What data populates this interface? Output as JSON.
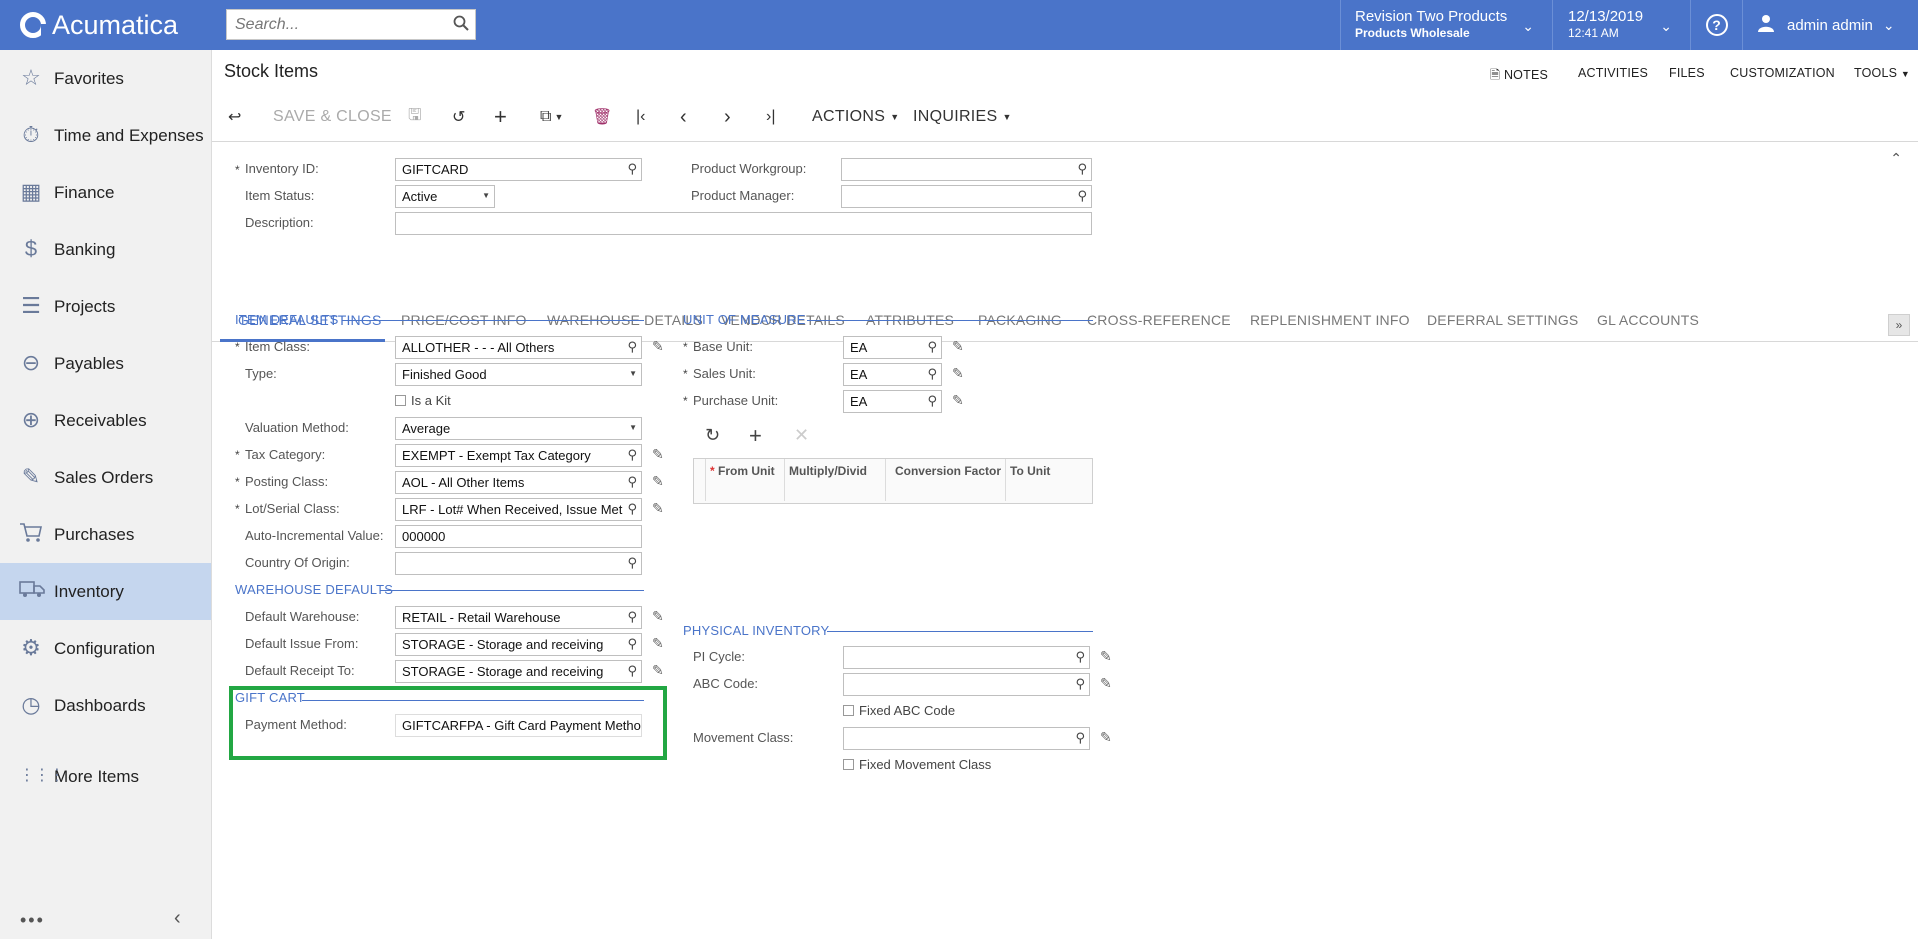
{
  "header": {
    "brand": "Acumatica",
    "search_placeholder": "Search...",
    "company_line1": "Revision Two Products",
    "company_line2": "Products Wholesale",
    "date": "12/13/2019",
    "time": "12:41 AM",
    "help": "?",
    "user": "admin admin"
  },
  "sidebar": {
    "items": [
      {
        "label": "Favorites",
        "icon": "star-icon"
      },
      {
        "label": "Time and Expenses",
        "icon": "stopwatch-icon"
      },
      {
        "label": "Finance",
        "icon": "calculator-icon"
      },
      {
        "label": "Banking",
        "icon": "dollar-icon"
      },
      {
        "label": "Projects",
        "icon": "projects-icon"
      },
      {
        "label": "Payables",
        "icon": "minus-circle-icon"
      },
      {
        "label": "Receivables",
        "icon": "plus-circle-icon"
      },
      {
        "label": "Sales Orders",
        "icon": "edit-icon"
      },
      {
        "label": "Purchases",
        "icon": "cart-icon"
      },
      {
        "label": "Inventory",
        "icon": "truck-icon"
      },
      {
        "label": "Configuration",
        "icon": "gear-icon"
      },
      {
        "label": "Dashboards",
        "icon": "gauge-icon"
      },
      {
        "label": "More Items",
        "icon": "grid-icon"
      }
    ],
    "active": "Inventory"
  },
  "page": {
    "title": "Stock Items",
    "topright": [
      "NOTES",
      "ACTIVITIES",
      "FILES",
      "CUSTOMIZATION",
      "TOOLS"
    ],
    "toolbar": {
      "save_close": "SAVE & CLOSE",
      "actions": "ACTIONS",
      "inquiries": "INQUIRIES"
    }
  },
  "form": {
    "inventory_id_label": "Inventory ID:",
    "inventory_id": "GIFTCARD",
    "item_status_label": "Item Status:",
    "item_status": "Active",
    "description_label": "Description:",
    "description": "",
    "product_workgroup_label": "Product Workgroup:",
    "product_workgroup": "",
    "product_manager_label": "Product Manager:",
    "product_manager": ""
  },
  "tabs": [
    "GENERAL SETTINGS",
    "PRICE/COST INFO",
    "WAREHOUSE DETAILS",
    "VENDOR DETAILS",
    "ATTRIBUTES",
    "PACKAGING",
    "CROSS-REFERENCE",
    "REPLENISHMENT INFO",
    "DEFERRAL SETTINGS",
    "GL ACCOUNTS"
  ],
  "item_defaults": {
    "title": "ITEM DEFAULTS",
    "item_class_label": "Item Class:",
    "item_class": "ALLOTHER  -   - - All Others",
    "type_label": "Type:",
    "type": "Finished Good",
    "is_kit_label": "Is a Kit",
    "valuation_label": "Valuation Method:",
    "valuation": "Average",
    "tax_label": "Tax Category:",
    "tax": "EXEMPT - Exempt Tax Category",
    "posting_label": "Posting Class:",
    "posting": "AOL - All Other Items",
    "lot_label": "Lot/Serial Class:",
    "lot": "LRF - Lot# When Received, Issue Met",
    "auto_label": "Auto-Incremental Value:",
    "auto": "000000",
    "country_label": "Country Of Origin:",
    "country": ""
  },
  "warehouse_defaults": {
    "title": "WAREHOUSE DEFAULTS",
    "default_wh_label": "Default Warehouse:",
    "default_wh": "RETAIL - Retail Warehouse",
    "issue_label": "Default Issue From:",
    "issue": "STORAGE - Storage and receiving",
    "receipt_label": "Default Receipt To:",
    "receipt": "STORAGE - Storage and receiving"
  },
  "gift_cart": {
    "title": "GIFT CART",
    "payment_label": "Payment Method:",
    "payment": "GIFTCARFPA - Gift Card Payment Metho"
  },
  "uom": {
    "title": "UNIT OF MEASURE",
    "base_label": "Base Unit:",
    "base": "EA",
    "sales_label": "Sales Unit:",
    "sales": "EA",
    "purchase_label": "Purchase Unit:",
    "purchase": "EA",
    "grid_cols": [
      "From Unit",
      "Multiply/Divid",
      "Conversion Factor",
      "To Unit"
    ]
  },
  "physical": {
    "title": "PHYSICAL INVENTORY",
    "pi_label": "PI Cycle:",
    "pi": "",
    "abc_label": "ABC Code:",
    "abc": "",
    "fixed_abc_label": "Fixed ABC Code",
    "movement_label": "Movement Class:",
    "movement": "",
    "fixed_movement_label": "Fixed Movement Class"
  }
}
